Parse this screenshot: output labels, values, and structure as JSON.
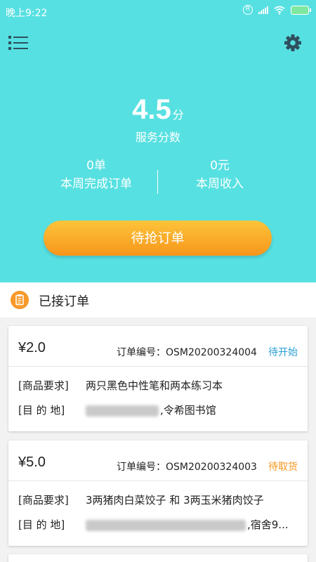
{
  "statusbar": {
    "time": "晚上9:22"
  },
  "header": {
    "score": "4.5",
    "score_unit": "分",
    "score_label": "服务分数"
  },
  "stats": {
    "orders_value": "0单",
    "orders_label": "本周完成订单",
    "income_value": "0元",
    "income_label": "本周收入"
  },
  "grab_button": "待抢订单",
  "section": {
    "title": "已接订单"
  },
  "orders": [
    {
      "price": "¥2.0",
      "order_no": "订单编号：OSM20200324004",
      "status": "待开始",
      "status_color": "#2a9fd6",
      "req_label": "[商品要求]",
      "req_value": "两只黑色中性笔和两本练习本",
      "dest_label": "[目 的 地]",
      "dest_value": ",令希图书馆"
    },
    {
      "price": "¥5.0",
      "order_no": "订单编号：OSM20200324003",
      "status": "待取货",
      "status_color": "#f7961c",
      "req_label": "[商品要求]",
      "req_value": "3两猪肉白菜饺子 和 3两玉米猪肉饺子",
      "dest_label": "[目 的 地]",
      "dest_value": ",宿舍9..."
    }
  ],
  "colors": {
    "primary": "#57e0e1",
    "accent": "#f7961c",
    "link": "#2a9fd6"
  }
}
